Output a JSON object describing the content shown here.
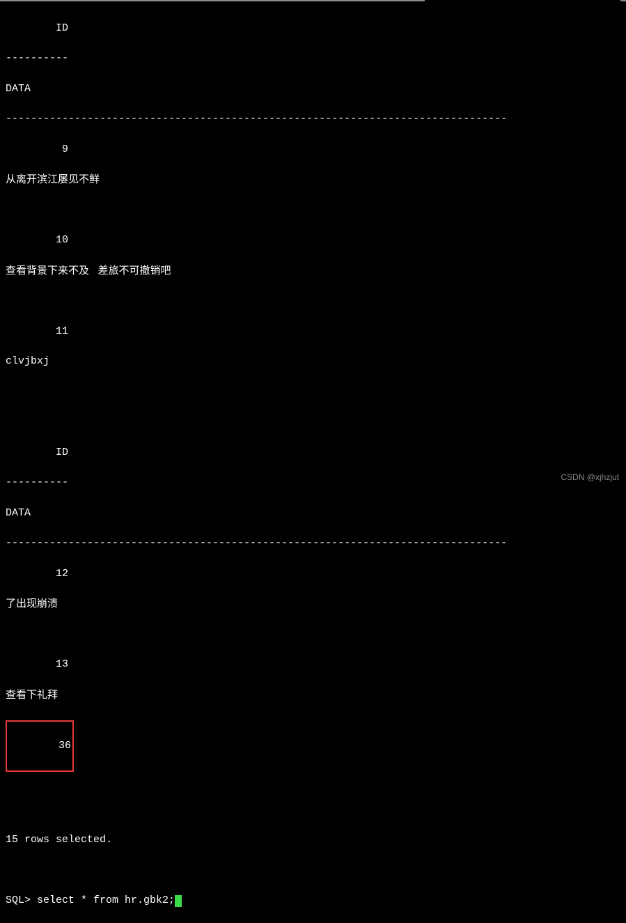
{
  "header1": {
    "id_label": "ID",
    "id_divider": "----------",
    "data_label": "DATA",
    "data_divider": "--------------------------------------------------------------------------------"
  },
  "rows1": [
    {
      "id": "         9",
      "data": "从离开滨江屡见不鲜"
    },
    {
      "id": "        10",
      "data": "查看背景下来不及   差旅不可撤销吧"
    },
    {
      "id": "        11",
      "data": "clvjbxj"
    }
  ],
  "header2": {
    "id_label": "ID",
    "id_divider": "----------",
    "data_label": "DATA",
    "data_divider": "--------------------------------------------------------------------------------"
  },
  "rows2": [
    {
      "id": "        12",
      "data": "了出现崩溃"
    },
    {
      "id": "        13",
      "data": "查看下礼拜"
    }
  ],
  "highlight_row": {
    "id": "        36"
  },
  "status": "15 rows selected.",
  "prompt": "SQL> ",
  "command": "select * from hr.gbk2;",
  "watermark": "CSDN @xjhzjut"
}
